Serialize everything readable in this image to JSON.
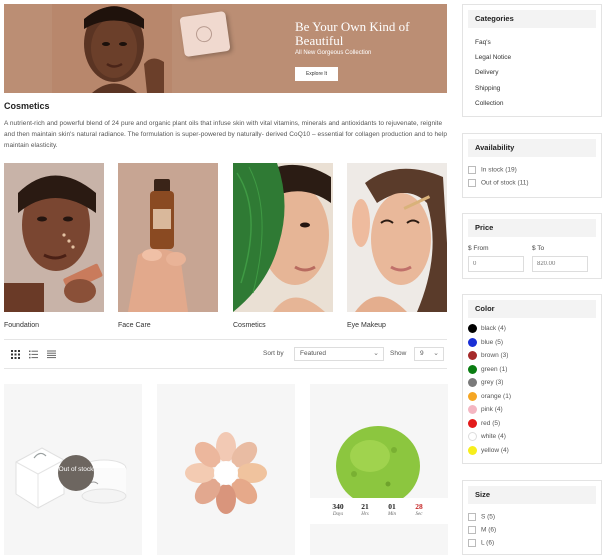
{
  "banner": {
    "title": "Be Your Own Kind of Beautiful",
    "subtitle": "All New Gorgeous Collection",
    "button_label": "Explore It"
  },
  "intro": {
    "title": "Cosmetics",
    "description": "A nutrient-rich and powerful blend of 24 pure and organic plant oils that infuse skin with vital vitamins, minerals and antioxidants to rejuvenate, reignite and then maintain skin's natural radiance. The formulation is super-powered by naturally- derived CoQ10 – essential for collagen production and to help maintain elasticity."
  },
  "categories": [
    {
      "label": "Foundation"
    },
    {
      "label": "Face Care"
    },
    {
      "label": "Cosmetics"
    },
    {
      "label": "Eye Makeup"
    }
  ],
  "toolbar": {
    "sort_label": "Sort by",
    "sort_value": "Featured",
    "show_label": "Show",
    "show_value": "9",
    "view_icons": [
      "grid-view-icon",
      "list-view-icon",
      "compact-list-view-icon"
    ]
  },
  "products": [
    {
      "badge": "Out of stock"
    },
    {},
    {
      "countdown": [
        {
          "value": "340",
          "unit": "Days"
        },
        {
          "value": "21",
          "unit": "Hrs"
        },
        {
          "value": "01",
          "unit": "Min"
        },
        {
          "value": "28",
          "unit": "Sec"
        }
      ]
    }
  ],
  "sidebar": {
    "categories": {
      "title": "Categories",
      "links": [
        "Faq's",
        "Legal Notice",
        "Delivery",
        "Shipping",
        "Collection"
      ]
    },
    "availability": {
      "title": "Availability",
      "options": [
        "In stock (19)",
        "Out of stock (11)"
      ]
    },
    "price": {
      "title": "Price",
      "from_label": "$ From",
      "to_label": "$ To",
      "from_placeholder": "0",
      "to_placeholder": "820.00"
    },
    "color": {
      "title": "Color",
      "options": [
        {
          "label": "black (4)",
          "hex": "#000000"
        },
        {
          "label": "blue (5)",
          "hex": "#1a2fd6"
        },
        {
          "label": "brown (3)",
          "hex": "#a52a2a"
        },
        {
          "label": "green (1)",
          "hex": "#0a7d12"
        },
        {
          "label": "grey (3)",
          "hex": "#7a7a7a"
        },
        {
          "label": "orange (1)",
          "hex": "#f5a623"
        },
        {
          "label": "pink (4)",
          "hex": "#f4b6c2"
        },
        {
          "label": "red (5)",
          "hex": "#e31b1b"
        },
        {
          "label": "white (4)",
          "hex": "#ffffff"
        },
        {
          "label": "yellow (4)",
          "hex": "#f7ee1c"
        }
      ]
    },
    "size": {
      "title": "Size",
      "options": [
        "S (5)",
        "M (6)",
        "L (6)"
      ]
    }
  },
  "colors": {
    "banner_bg": "#bb8e74",
    "price_accent": "#c62828"
  }
}
